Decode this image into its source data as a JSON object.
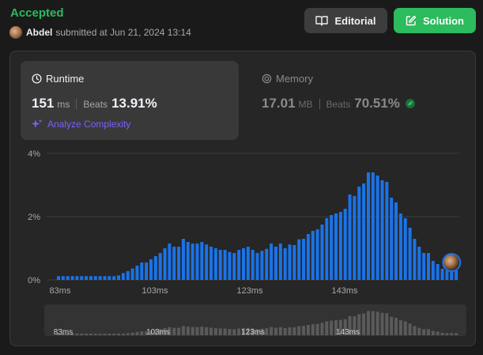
{
  "header": {
    "status": "Accepted",
    "submitter": "Abdel",
    "submitted_text": "submitted at Jun 21, 2024 13:14"
  },
  "buttons": {
    "editorial": "Editorial",
    "solution": "Solution"
  },
  "runtime": {
    "label": "Runtime",
    "value": "151",
    "unit": "ms",
    "beats_label": "Beats",
    "beats_value": "13.91%",
    "analyze": "Analyze Complexity"
  },
  "memory": {
    "label": "Memory",
    "value": "17.01",
    "unit": "MB",
    "beats_label": "Beats",
    "beats_value": "70.51%"
  },
  "colors": {
    "accepted": "#2cbb5d",
    "bar": "#1a73e8",
    "bar_user": "#1a73e8",
    "mini_bar": "#5a5a5a",
    "analyze": "#7b61ff"
  },
  "chart_data": {
    "type": "bar",
    "title": "",
    "xlabel": "",
    "ylabel": "",
    "yticks": [
      "4%",
      "2%",
      "0%"
    ],
    "ylim": [
      0,
      4
    ],
    "xticks": [
      "83ms",
      "103ms",
      "123ms",
      "143ms"
    ],
    "x_start_ms": 83,
    "x_step_ms": 0.8,
    "user_runtime_ms": 151,
    "values": [
      0.12,
      0.12,
      0.12,
      0.12,
      0.12,
      0.12,
      0.12,
      0.12,
      0.12,
      0.12,
      0.12,
      0.12,
      0.12,
      0.14,
      0.22,
      0.28,
      0.36,
      0.45,
      0.55,
      0.55,
      0.65,
      0.75,
      0.85,
      1.0,
      1.15,
      1.05,
      1.05,
      1.3,
      1.2,
      1.15,
      1.15,
      1.2,
      1.12,
      1.05,
      1.0,
      0.95,
      0.95,
      0.88,
      0.85,
      0.95,
      1.0,
      1.05,
      0.95,
      0.85,
      0.92,
      0.98,
      1.15,
      1.05,
      1.15,
      1.0,
      1.12,
      1.1,
      1.28,
      1.3,
      1.45,
      1.55,
      1.6,
      1.75,
      1.95,
      2.05,
      2.1,
      2.15,
      2.25,
      2.7,
      2.65,
      2.95,
      3.05,
      3.4,
      3.4,
      3.3,
      3.15,
      3.1,
      2.6,
      2.45,
      2.1,
      1.95,
      1.65,
      1.3,
      1.05,
      0.85,
      0.85,
      0.6,
      0.5,
      0.35,
      0.3,
      0.3,
      0.3
    ]
  }
}
